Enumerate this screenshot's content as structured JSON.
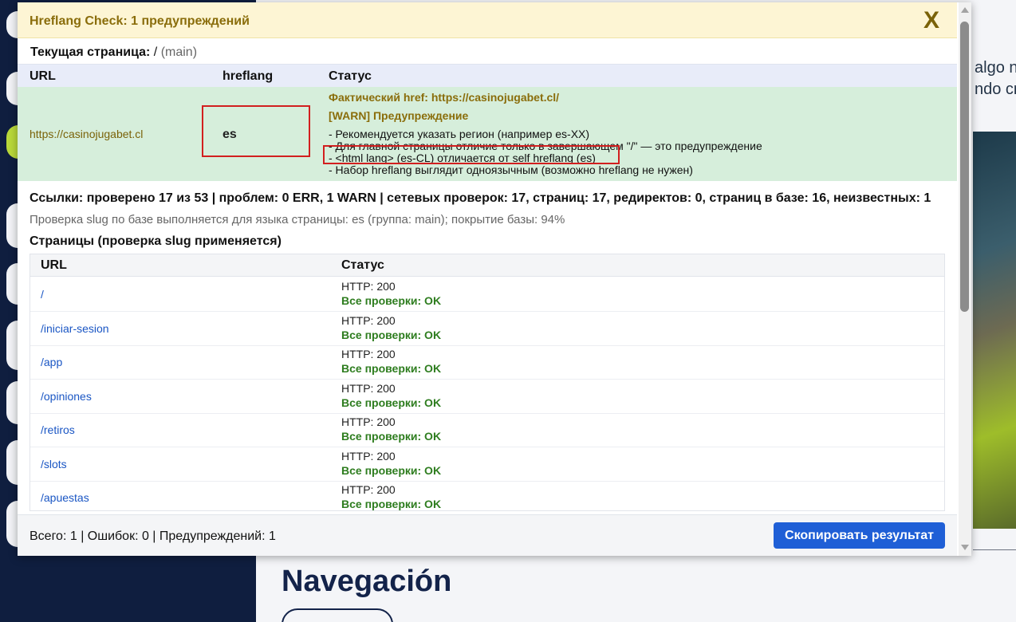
{
  "background": {
    "text_line1": "algo n",
    "text_line2": "ndo cr",
    "heading": "Navegación"
  },
  "popup": {
    "title": "Hreflang Check: 1 предупреждений",
    "close_label": "X",
    "current_page_label": "Текущая страница:",
    "current_page_path": "/",
    "current_page_group": "(main)",
    "hreflang_table": {
      "headers": [
        "URL",
        "hreflang",
        "Статус"
      ],
      "row": {
        "url": "https://casinojugabet.cl",
        "hreflang": "es",
        "actual_href": "Фактический href: https://casinojugabet.cl/",
        "warn_title": "[WARN] Предупреждение",
        "messages": [
          "- Рекомендуется указать регион (например es-XX)",
          "- Для главной страницы отличие только в завершающем \"/\" — это предупреждение",
          "- <html lang> (es-CL) отличается от self hreflang (es)",
          "- Набор hreflang выглядит одноязычным (возможно hreflang не нужен)"
        ]
      }
    },
    "links_summary": "Ссылки: проверено 17 из 53 | проблем: 0 ERR, 1 WARN | сетевых проверок: 17, страниц: 17, редиректов: 0, страниц в базе: 16, неизвестных: 1",
    "slug_note": "Проверка slug по базе выполняется для языка страницы: es (группа: main); покрытие базы: 94%",
    "pages_title": "Страницы (проверка slug применяется)",
    "pages_table": {
      "headers": [
        "URL",
        "Статус"
      ],
      "rows": [
        {
          "url": "/",
          "http": "HTTP: 200",
          "result": "Все проверки: OK"
        },
        {
          "url": "/iniciar-sesion",
          "http": "HTTP: 200",
          "result": "Все проверки: OK"
        },
        {
          "url": "/app",
          "http": "HTTP: 200",
          "result": "Все проверки: OK"
        },
        {
          "url": "/opiniones",
          "http": "HTTP: 200",
          "result": "Все проверки: OK"
        },
        {
          "url": "/retiros",
          "http": "HTTP: 200",
          "result": "Все проверки: OK"
        },
        {
          "url": "/slots",
          "http": "HTTP: 200",
          "result": "Все проверки: OK"
        },
        {
          "url": "/apuestas",
          "http": "HTTP: 200",
          "result": "Все проверки: OK"
        }
      ]
    },
    "footer_summary": "Всего: 1 | Ошибок: 0 | Предупреждений: 1",
    "copy_button": "Скопировать результат"
  },
  "colors": {
    "header_bg": "#fdf5d4",
    "row_ok_bg": "#d6eedb",
    "accent_button": "#1f5fd6",
    "warn_text": "#8a6d0b",
    "ok_text": "#2e7d1f",
    "highlight_box": "#d21f1f"
  }
}
